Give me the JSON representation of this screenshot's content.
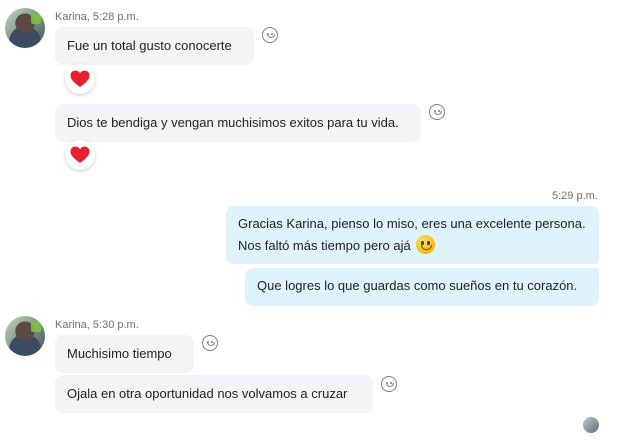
{
  "group1": {
    "sender": "Karina",
    "time": "5:28 p.m.",
    "messages": [
      {
        "text": "Fue un total gusto conocerte",
        "reaction": "heart-icon"
      },
      {
        "text": "Dios te bendiga y vengan muchisimos exitos para tu vida.",
        "reaction": "heart-icon"
      }
    ]
  },
  "outgoing": {
    "time": "5:29 p.m.",
    "messages": [
      {
        "line1": "Gracias Karina, pienso lo miso, eres una excelente persona.",
        "line2": "Nos faltó más tiempo pero ajá",
        "emoji": "smile-emoji"
      },
      {
        "text": "Que logres lo que guardas como sueños en tu corazón."
      }
    ]
  },
  "group2": {
    "sender": "Karina",
    "time": "5:30 p.m.",
    "messages": [
      {
        "text": "Muchisimo tiempo"
      },
      {
        "text": "Ojala en otra oportunidad nos volvamos a cruzar"
      }
    ]
  },
  "colors": {
    "incoming_bubble": "#f2f4f6",
    "outgoing_bubble": "#dff3fd",
    "heart": "#e8202f",
    "meta_text": "#6f6f6f"
  },
  "icons": {
    "react": "smiley-react-icon",
    "heart": "heart-icon",
    "read_receipt": "read-receipt-avatar"
  }
}
